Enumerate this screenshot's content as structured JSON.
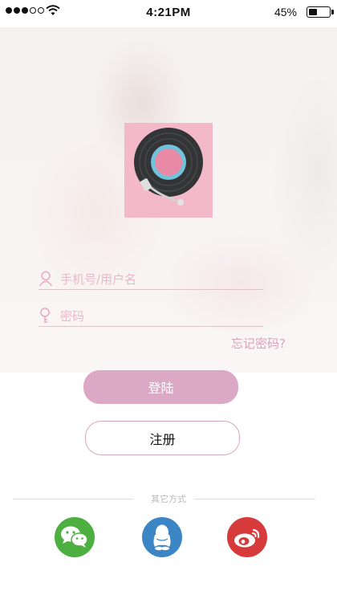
{
  "status_bar": {
    "time": "4:21PM",
    "battery_percent": "45%",
    "battery_level": 0.45,
    "signal_bars_filled": 3,
    "signal_bars_total": 5
  },
  "login_form": {
    "username_placeholder": "手机号/用户名",
    "password_placeholder": "密码",
    "forgot_password": "忘记密码?"
  },
  "buttons": {
    "login": "登陆",
    "register": "注册"
  },
  "social": {
    "divider_label": "其它方式",
    "providers": [
      {
        "name": "wechat",
        "icon": "wechat-icon",
        "color": "#4caf3f"
      },
      {
        "name": "qq",
        "icon": "qq-penguin-icon",
        "color": "#3d86c6"
      },
      {
        "name": "weibo",
        "icon": "weibo-icon",
        "color": "#d63a3a"
      }
    ]
  },
  "colors": {
    "accent_pink": "#dba8c6",
    "placeholder_pink": "#e9b7cb",
    "logo_background": "#f3b9c9"
  }
}
